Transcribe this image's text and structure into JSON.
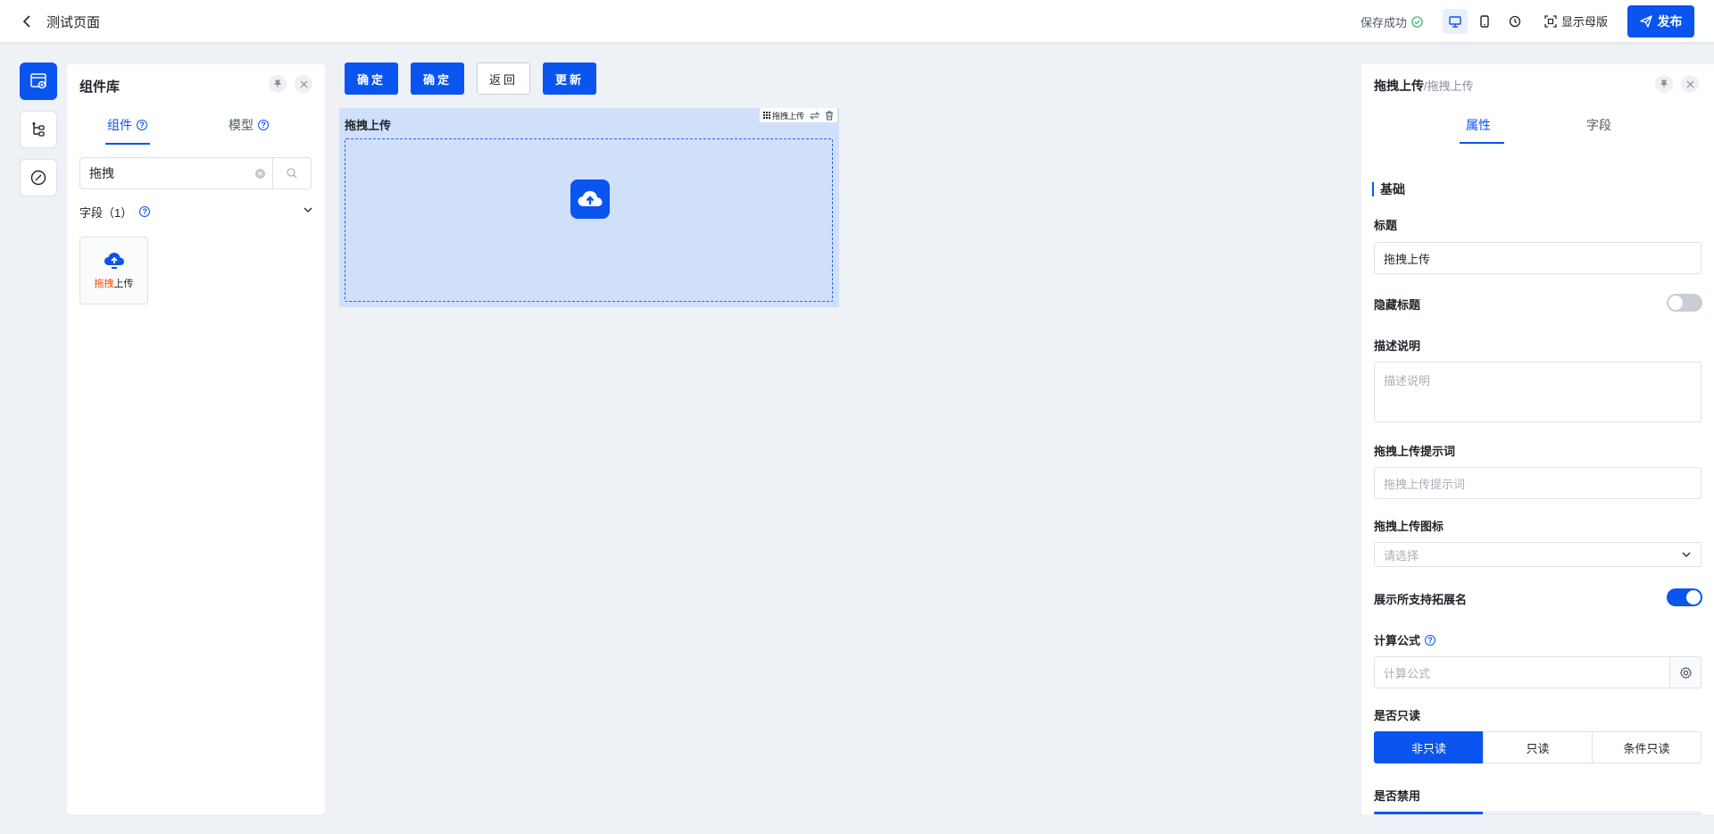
{
  "header": {
    "title": "测试页面",
    "save_status": "保存成功",
    "show_master_label": "显示母版",
    "publish_label": "发布"
  },
  "library": {
    "title": "组件库",
    "tabs": [
      {
        "label": "组件",
        "active": true
      },
      {
        "label": "模型",
        "active": false
      }
    ],
    "search_value": "拖拽",
    "group_label": "字段（1）",
    "component": {
      "label_highlight": "拖拽",
      "label_rest": "上传"
    }
  },
  "canvas": {
    "buttons": [
      {
        "label": "确定",
        "style": "primary"
      },
      {
        "label": "确定",
        "style": "primary"
      },
      {
        "label": "返回",
        "style": "plain"
      },
      {
        "label": "更新",
        "style": "primary"
      }
    ],
    "upload": {
      "title": "拖拽上传",
      "toolbar_label": "拖拽上传"
    }
  },
  "properties": {
    "title": "拖拽上传",
    "title_sub": "/拖拽上传",
    "tabs": [
      {
        "label": "属性",
        "active": true
      },
      {
        "label": "字段",
        "active": false
      }
    ],
    "section": "基础",
    "fields": {
      "title_label": "标题",
      "title_value": "拖拽上传",
      "hide_title_label": "隐藏标题",
      "hide_title_on": false,
      "desc_label": "描述说明",
      "desc_placeholder": "描述说明",
      "hint_label": "拖拽上传提示词",
      "hint_placeholder": "拖拽上传提示词",
      "icon_label": "拖拽上传图标",
      "icon_placeholder": "请选择",
      "show_ext_label": "展示所支持拓展名",
      "show_ext_on": true,
      "formula_label": "计算公式",
      "formula_placeholder": "计算公式",
      "readonly_label": "是否只读",
      "readonly_options": [
        "非只读",
        "只读",
        "条件只读"
      ],
      "readonly_selected": "非只读",
      "disabled_label": "是否禁用"
    }
  },
  "colors": {
    "primary": "#0a54f0",
    "canvas_bg": "#eef1f6",
    "upload_bg": "#d1e0fa",
    "success": "#2bb673",
    "highlight": "#f54a00"
  }
}
